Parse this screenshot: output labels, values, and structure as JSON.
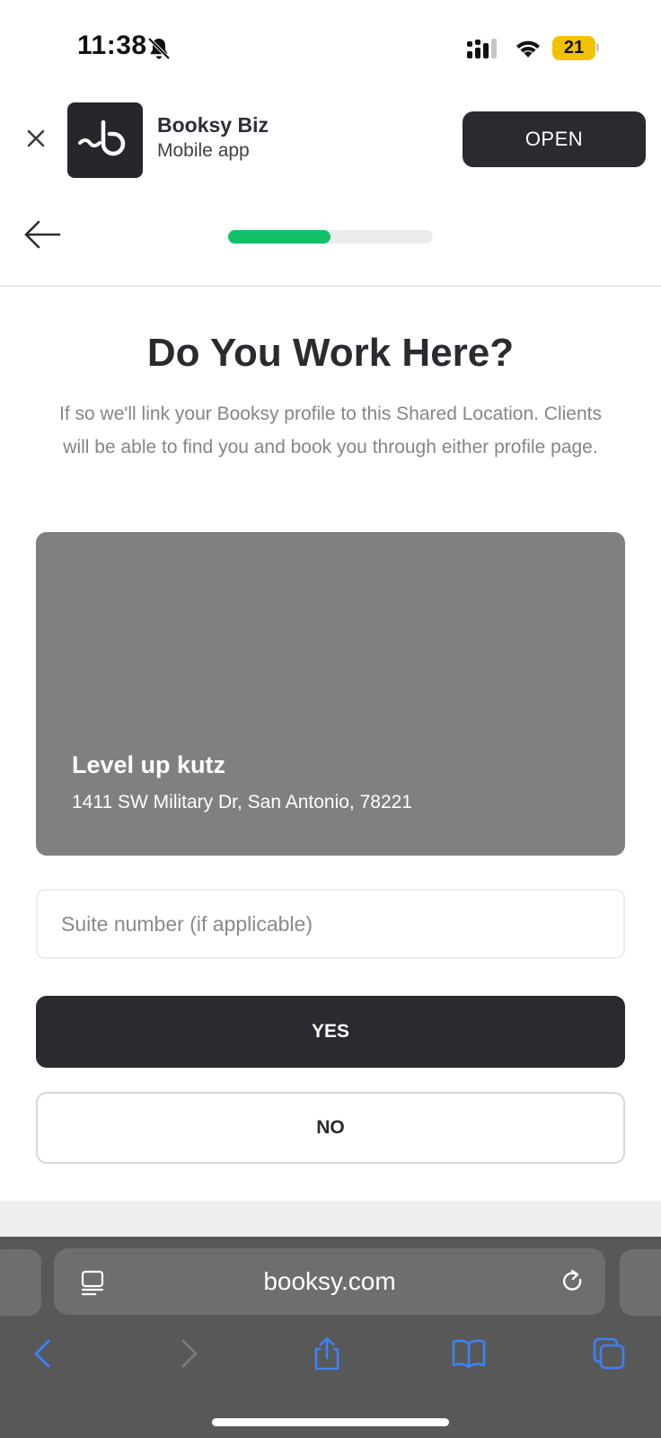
{
  "status_bar": {
    "time": "11:38",
    "battery_level": "21",
    "icons": [
      "bell-slash-icon",
      "cellular-signal-icon",
      "wifi-icon",
      "battery-icon"
    ]
  },
  "app_banner": {
    "app_name": "Booksy Biz",
    "subtitle": "Mobile app",
    "open_label": "OPEN",
    "icons": [
      "close-icon",
      "booksy-logo-icon"
    ]
  },
  "nav": {
    "progress": 0.5,
    "progress_color": "#13c06a"
  },
  "main": {
    "title": "Do You Work Here?",
    "description": "If so we'll link your Booksy profile to this Shared Location. Clients will be able to find you and book you through either profile page.",
    "location": {
      "name": "Level up kutz",
      "address": "1411 SW Military Dr, San Antonio, 78221"
    },
    "suite_input": {
      "placeholder": "Suite number (if applicable)",
      "value": ""
    },
    "yes_label": "YES",
    "no_label": "NO"
  },
  "browser": {
    "url": "booksy.com",
    "icons": [
      "reader-icon",
      "reload-icon",
      "back-icon",
      "forward-icon",
      "share-icon",
      "bookmarks-icon",
      "tabs-icon"
    ],
    "accent_color": "#3b82f6"
  },
  "colors": {
    "primary_dark": "#2a2b30",
    "card_gray": "#808080",
    "muted_text": "#858585"
  }
}
